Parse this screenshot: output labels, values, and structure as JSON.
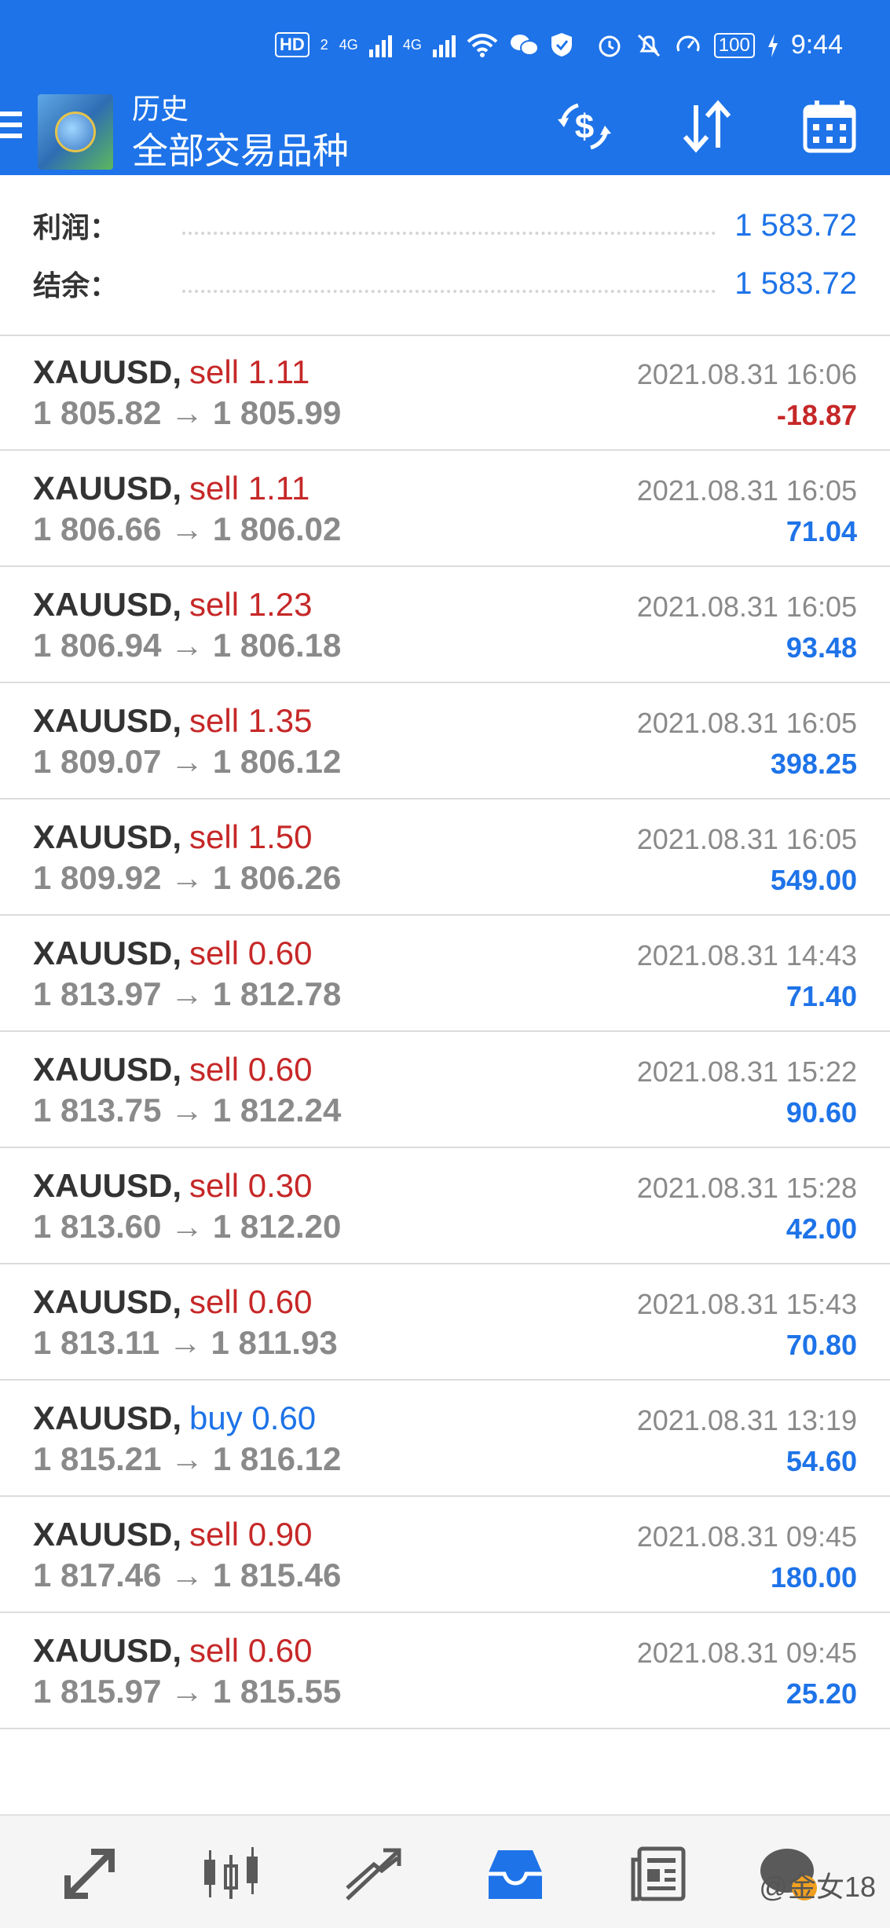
{
  "status_bar": {
    "hd_badge": "HD",
    "sim": "2",
    "net1": "4G",
    "net2": "4G",
    "battery": "100",
    "time": "9:44"
  },
  "app_bar": {
    "title_small": "历史",
    "title_big": "全部交易品种"
  },
  "summary": {
    "profit_label": "利润：",
    "profit_value": "1 583.72",
    "balance_label": "结余：",
    "balance_value": "1 583.72"
  },
  "trades": [
    {
      "symbol": "XAUUSD",
      "side": "sell",
      "volume": "1.11",
      "open": "1 805.82",
      "close": "1 805.99",
      "time": "2021.08.31 16:06",
      "profit": "-18.87"
    },
    {
      "symbol": "XAUUSD",
      "side": "sell",
      "volume": "1.11",
      "open": "1 806.66",
      "close": "1 806.02",
      "time": "2021.08.31 16:05",
      "profit": "71.04"
    },
    {
      "symbol": "XAUUSD",
      "side": "sell",
      "volume": "1.23",
      "open": "1 806.94",
      "close": "1 806.18",
      "time": "2021.08.31 16:05",
      "profit": "93.48"
    },
    {
      "symbol": "XAUUSD",
      "side": "sell",
      "volume": "1.35",
      "open": "1 809.07",
      "close": "1 806.12",
      "time": "2021.08.31 16:05",
      "profit": "398.25"
    },
    {
      "symbol": "XAUUSD",
      "side": "sell",
      "volume": "1.50",
      "open": "1 809.92",
      "close": "1 806.26",
      "time": "2021.08.31 16:05",
      "profit": "549.00"
    },
    {
      "symbol": "XAUUSD",
      "side": "sell",
      "volume": "0.60",
      "open": "1 813.97",
      "close": "1 812.78",
      "time": "2021.08.31 14:43",
      "profit": "71.40"
    },
    {
      "symbol": "XAUUSD",
      "side": "sell",
      "volume": "0.60",
      "open": "1 813.75",
      "close": "1 812.24",
      "time": "2021.08.31 15:22",
      "profit": "90.60"
    },
    {
      "symbol": "XAUUSD",
      "side": "sell",
      "volume": "0.30",
      "open": "1 813.60",
      "close": "1 812.20",
      "time": "2021.08.31 15:28",
      "profit": "42.00"
    },
    {
      "symbol": "XAUUSD",
      "side": "sell",
      "volume": "0.60",
      "open": "1 813.11",
      "close": "1 811.93",
      "time": "2021.08.31 15:43",
      "profit": "70.80"
    },
    {
      "symbol": "XAUUSD",
      "side": "buy",
      "volume": "0.60",
      "open": "1 815.21",
      "close": "1 816.12",
      "time": "2021.08.31 13:19",
      "profit": "54.60"
    },
    {
      "symbol": "XAUUSD",
      "side": "sell",
      "volume": "0.90",
      "open": "1 817.46",
      "close": "1 815.46",
      "time": "2021.08.31 09:45",
      "profit": "180.00"
    },
    {
      "symbol": "XAUUSD",
      "side": "sell",
      "volume": "0.60",
      "open": "1 815.97",
      "close": "1 815.55",
      "time": "2021.08.31 09:45",
      "profit": "25.20"
    }
  ],
  "bottom_nav": {
    "items": [
      "quotes-icon",
      "chart-icon",
      "trade-icon",
      "history-icon",
      "news-icon",
      "chat-icon"
    ],
    "active": "history-icon",
    "watermark": "@金女18"
  },
  "colors": {
    "primary": "#1e73e8",
    "sell": "#c62828",
    "negative": "#c62828",
    "positive": "#1e73e8",
    "muted": "#8a8a8a"
  }
}
